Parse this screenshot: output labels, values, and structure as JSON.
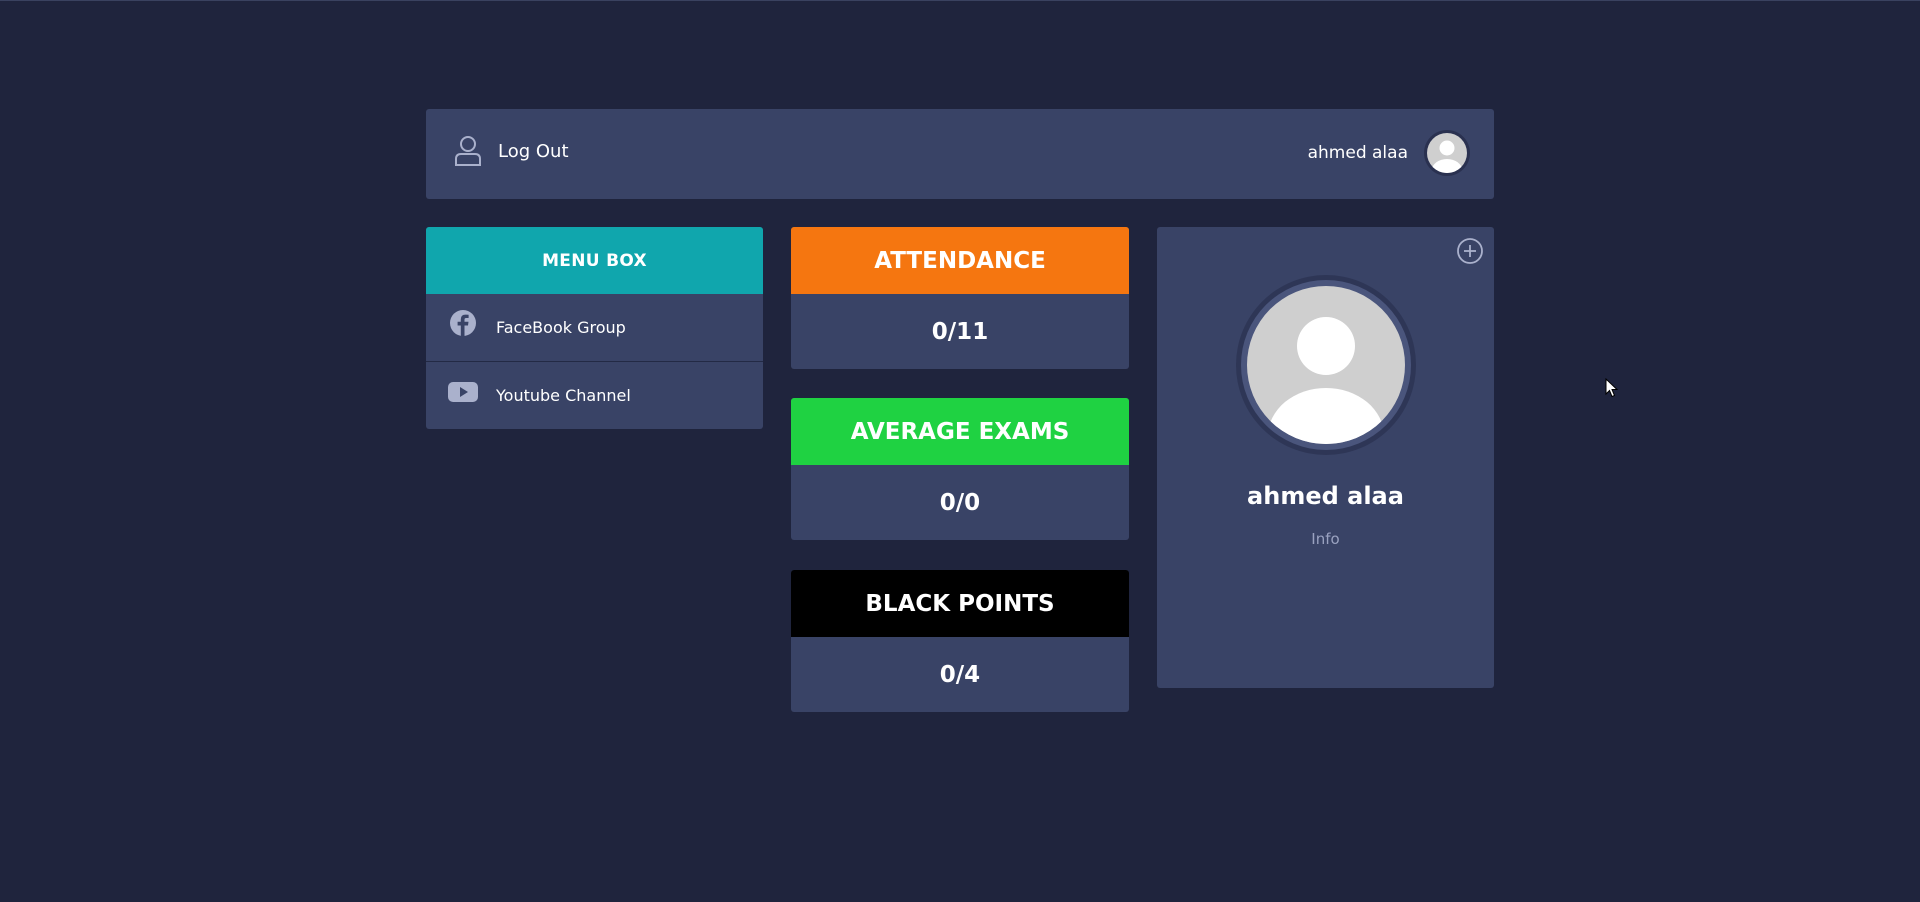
{
  "header": {
    "logout_label": "Log Out",
    "user_name": "ahmed alaa"
  },
  "menu": {
    "title": "MENU BOX",
    "items": [
      {
        "label": "FaceBook Group",
        "icon": "facebook-icon"
      },
      {
        "label": "Youtube Channel",
        "icon": "youtube-icon"
      }
    ]
  },
  "stats": [
    {
      "title": "ATTENDANCE",
      "value": "0/11",
      "color": "#f57610"
    },
    {
      "title": "AVERAGE EXAMS",
      "value": "0/0",
      "color": "#1fd242"
    },
    {
      "title": "BLACK POINTS",
      "value": "0/4",
      "color": "#000000"
    }
  ],
  "profile": {
    "name": "ahmed alaa",
    "info_label": "Info"
  },
  "colors": {
    "background": "#1f243d",
    "panel": "#394366",
    "menu_header": "#10a6ad"
  }
}
